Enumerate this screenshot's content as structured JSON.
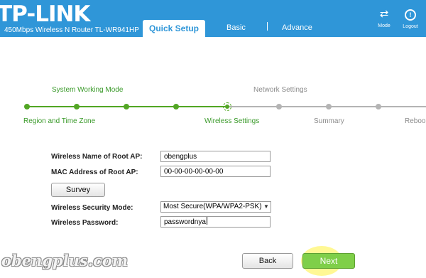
{
  "header": {
    "logo_text": "TP-LINK",
    "model": "450Mbps Wireless N Router TL-WR941HP",
    "tabs": [
      {
        "label": "Quick Setup",
        "active": true
      },
      {
        "label": "Basic",
        "active": false
      },
      {
        "label": "Advance",
        "active": false
      }
    ],
    "mode": {
      "label": "Mode",
      "icon": "swap-arrows-icon"
    },
    "logout": {
      "label": "Logout",
      "icon": "power-icon"
    },
    "accent_color": "#2f96d8"
  },
  "stepper": {
    "steps": [
      {
        "label": "Region and Time Zone",
        "status": "done"
      },
      {
        "label": "System Working Mode",
        "status": "done"
      },
      {
        "label": "",
        "status": "done"
      },
      {
        "label": "",
        "status": "done"
      },
      {
        "label": "Wireless Settings",
        "status": "current"
      },
      {
        "label": "Network Settings",
        "status": "todo"
      },
      {
        "label": "Summary",
        "status": "todo"
      },
      {
        "label": "",
        "status": "todo"
      },
      {
        "label": "Reboo",
        "status": "todo"
      }
    ],
    "done_color": "#52a624",
    "todo_color": "#b4b4b4"
  },
  "form": {
    "root_ap_name": {
      "label": "Wireless Name of Root AP:",
      "value": "obengplus"
    },
    "root_ap_mac": {
      "label": "MAC Address of Root AP:",
      "value": "00-00-00-00-00-00"
    },
    "survey_button": "Survey",
    "security_mode": {
      "label": "Wireless Security Mode:",
      "value": "Most Secure(WPA/WPA2-PSK)"
    },
    "password": {
      "label": "Wireless Password:",
      "value": "passwordnya"
    }
  },
  "actions": {
    "back": "Back",
    "next": "Next"
  },
  "watermark": "obengplus.com"
}
